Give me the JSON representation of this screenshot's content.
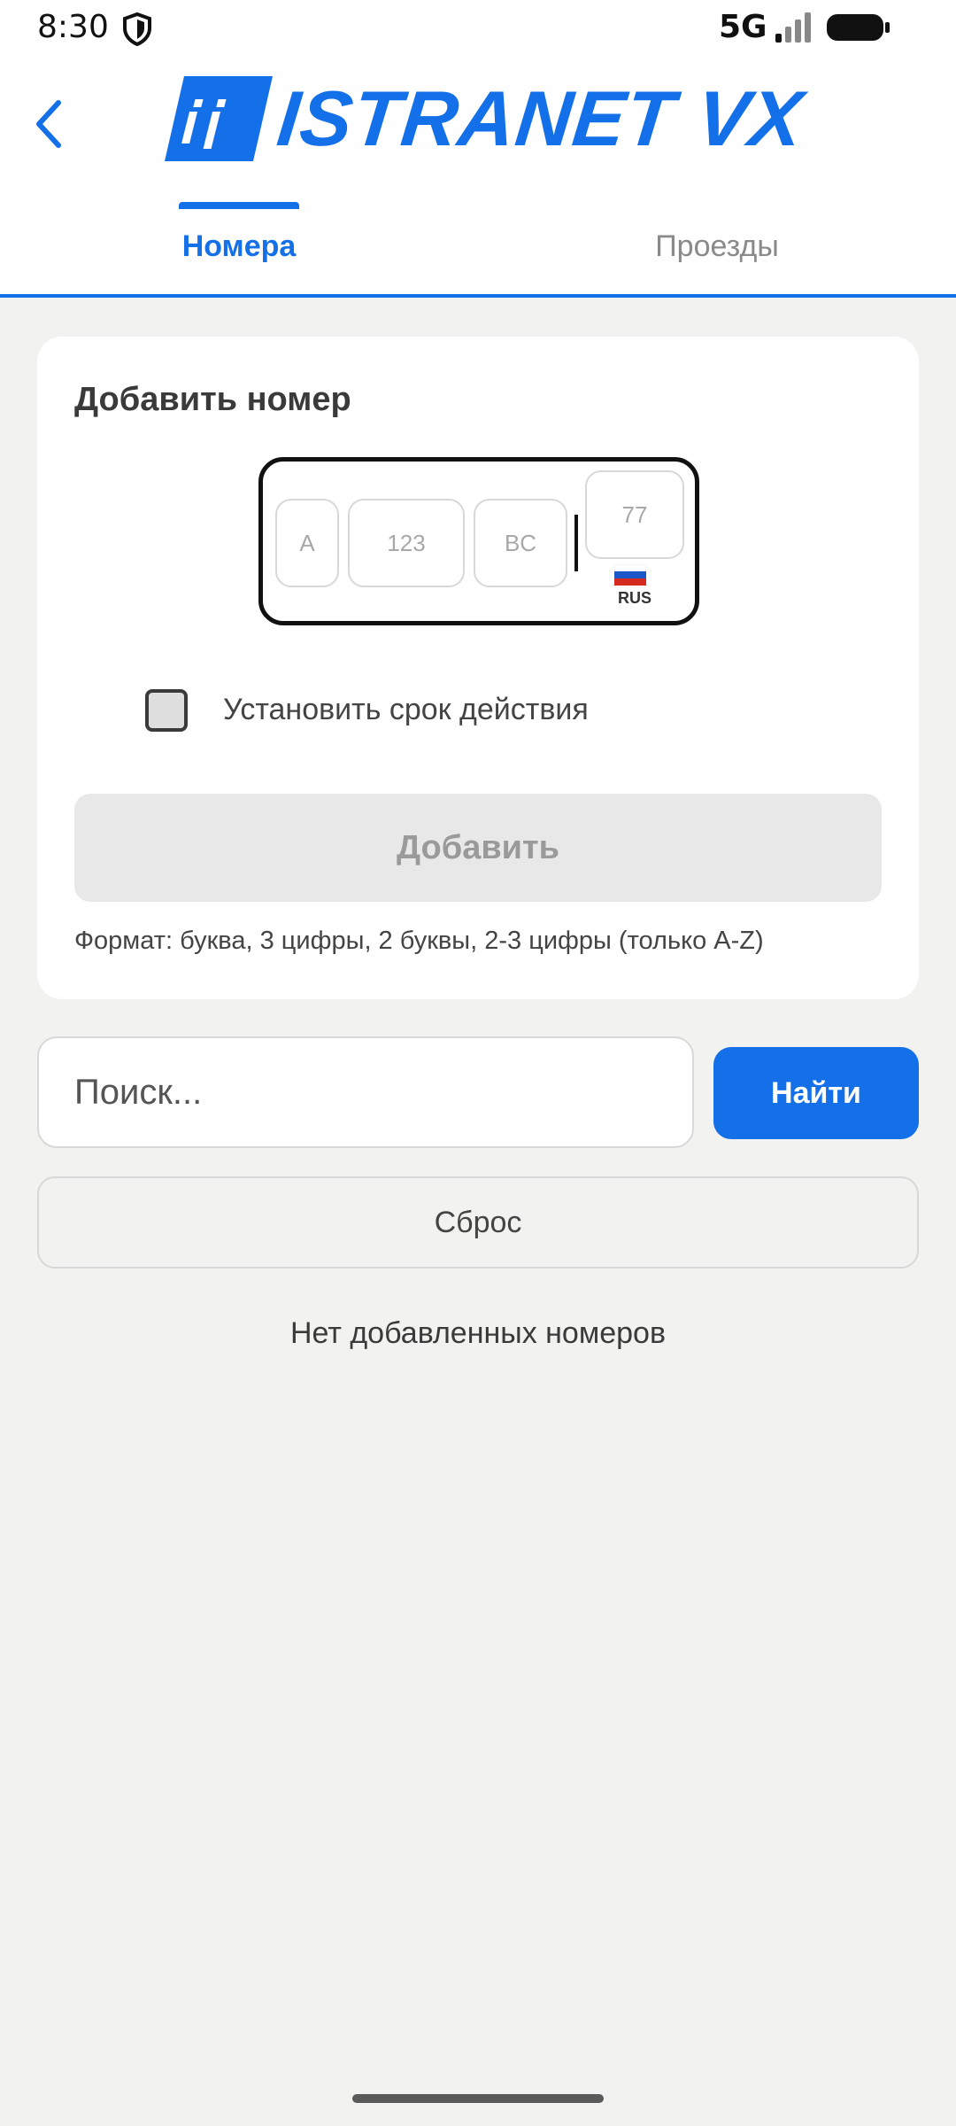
{
  "status_bar": {
    "time": "8:30",
    "network": "5G",
    "icons": [
      "shield-icon",
      "signal-icon",
      "battery-icon"
    ]
  },
  "header": {
    "logo_text": "ISTRANET VX",
    "logo_mark": "ij",
    "back_icon": "chevron-left-icon",
    "tabs": [
      {
        "label": "Номера",
        "active": true
      },
      {
        "label": "Проезды",
        "active": false
      }
    ]
  },
  "add_card": {
    "title": "Добавить номер",
    "plate": {
      "letter_placeholder": "A",
      "digits_placeholder": "123",
      "series_placeholder": "BC",
      "region_placeholder": "77",
      "country": "RUS"
    },
    "checkbox_label": "Установить срок действия",
    "checkbox_checked": false,
    "add_button": "Добавить",
    "format_hint": "Формат: буква, 3 цифры, 2 буквы, 2-3 цифры (только A-Z)"
  },
  "search": {
    "placeholder": "Поиск...",
    "value": "",
    "find_button": "Найти",
    "reset_button": "Сброс"
  },
  "empty_state": "Нет добавленных номеров",
  "colors": {
    "accent": "#1470e8",
    "background": "#f2f2f1",
    "card": "#ffffff",
    "disabled_button": "#e7e8e7"
  }
}
